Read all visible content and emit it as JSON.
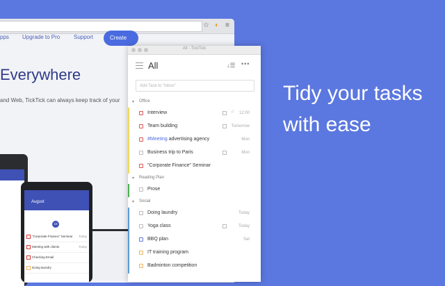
{
  "background_color": "#5b77e0",
  "website": {
    "nav": [
      "pps",
      "Upgrade to Pro",
      "Support"
    ],
    "create_label": "Create",
    "hero_title": "Everywhere",
    "hero_text": "and Web, TickTick can always keep track of your"
  },
  "phone": {
    "month": "August",
    "today_badge": "10",
    "tasks": [
      {
        "title": "\"Corporate Finance\" Seminar",
        "due": "Today"
      },
      {
        "title": "Meeting with clients",
        "due": "Today"
      },
      {
        "title": "Checking Email",
        "due": ""
      },
      {
        "title": "Doing laundry",
        "due": ""
      }
    ]
  },
  "app": {
    "window_title": "All - TickTick",
    "list_title": "All",
    "add_placeholder": "Add Task to \"Inbox\"",
    "groups": [
      {
        "name": "Office",
        "color": "#f0d75c",
        "tasks": [
          {
            "title": "Interview",
            "due": "12:00",
            "priority": "#e05252",
            "note": true,
            "bell": true
          },
          {
            "title": "Team building",
            "due": "Tomorrow",
            "priority": "#e05252",
            "note": true
          },
          {
            "title_tag": "#Meeting",
            "title": " advertising agency",
            "due": "Mon",
            "priority": "#e05252"
          },
          {
            "title": "Business trip to Paris",
            "due": "Mon",
            "priority": "#bbbbbb",
            "note": true
          },
          {
            "title": "\"Corporate Finance\" Seminar",
            "due": "",
            "priority": "#e05252"
          }
        ]
      },
      {
        "name": "Reading Plan",
        "color": "#4caf50",
        "tasks": [
          {
            "title": "Prose",
            "due": "",
            "priority": "#bbbbbb"
          }
        ]
      },
      {
        "name": "Social",
        "color": "#5b9bd5",
        "tasks": [
          {
            "title": "Doing laundry",
            "due": "Today",
            "priority": "#bbbbbb"
          },
          {
            "title": "Yoga class",
            "due": "Today",
            "priority": "#bbbbbb",
            "note": true
          },
          {
            "title": "BBQ plan",
            "due": "Sat",
            "priority": "#5b77e0"
          },
          {
            "title": "IT training program",
            "due": "",
            "priority": "#f0b45c"
          },
          {
            "title": "Badminton competition",
            "due": "",
            "priority": "#f0b45c"
          }
        ]
      }
    ]
  },
  "tagline": [
    "Tidy your tasks",
    "with ease"
  ]
}
